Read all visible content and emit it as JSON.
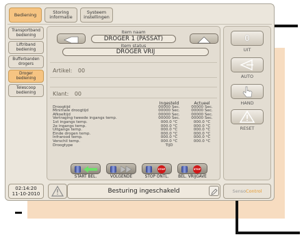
{
  "tabs": [
    {
      "label": "Bediening",
      "active": true
    },
    {
      "label": "Storing informatie",
      "active": false
    },
    {
      "label": "Systeem instellingen",
      "active": false
    }
  ],
  "sidebar": {
    "items": [
      {
        "label": "Transportband bediening",
        "active": false
      },
      {
        "label": "Liftriband bediening",
        "active": false
      },
      {
        "label": "Bufferbanden drogers",
        "active": false
      },
      {
        "label": "Droger bediening",
        "active": true
      },
      {
        "label": "Telescoop bediening",
        "active": false
      }
    ]
  },
  "item": {
    "name_label": "Item naam",
    "name_value": "DROGER 1 (PASSAT)",
    "status_label": "Item status",
    "status_value": "DROGER VRIJ"
  },
  "artikel": {
    "label": "Artikel:",
    "value": "00"
  },
  "klant": {
    "label": "Klant:",
    "value": "00"
  },
  "table": {
    "headers": {
      "set": "Ingesteld",
      "actual": "Actueel"
    },
    "rows": [
      {
        "label": "Droogtijd",
        "set": "00000 Sec.",
        "actual": "00000 Sec."
      },
      {
        "label": "Minimale droogtijd",
        "set": "00000 Sec.",
        "actual": "00000 Sec."
      },
      {
        "label": "Afkoeltijd",
        "set": "00000 Sec.",
        "actual": "00000 Sec."
      },
      {
        "label": "Vertraging tweede ingangs temp.",
        "set": "00000 Sec.",
        "actual": "00000 Sec."
      },
      {
        "label": "1st ingangs temp.",
        "set": "000.0 °C",
        "actual": "000.0 °C"
      },
      {
        "label": "2e ingangs temp.",
        "set": "000.0 °C",
        "actual": "000.0 °C"
      },
      {
        "label": "Uitgangs temp.",
        "set": "000.0 °C",
        "actual": "000.0 °C"
      },
      {
        "label": "Einde drogen temp.",
        "set": "000.0 °C",
        "actual": "000.0 °C"
      },
      {
        "label": "Infrarood temp.",
        "set": "000.0 °C",
        "actual": "000.0 °C"
      },
      {
        "label": "Verschil temp.",
        "set": "000.0 °C",
        "actual": "000.0 °C"
      },
      {
        "label": "Droogtype",
        "set": "TIJD",
        "actual": ""
      }
    ]
  },
  "actions": [
    {
      "label": "START BEL."
    },
    {
      "label": "VOLGENDE"
    },
    {
      "label": "STOP ONTL."
    },
    {
      "label": "BEL. VRIJGAVE"
    }
  ],
  "stop_text": "STOP",
  "modes": {
    "uit": {
      "glyph": "0",
      "label": "UIT"
    },
    "auto": {
      "label": "AUTO"
    },
    "hand": {
      "label": "HAND"
    },
    "reset": {
      "glyph": "!",
      "label": "RESET"
    }
  },
  "footer": {
    "time": "02:14:20",
    "date": "11-10-2010",
    "status": "Besturing ingeschakeld",
    "brand_prefix": "Senso",
    "brand_suffix": "Control"
  },
  "colors": {
    "accent": "#f6c482",
    "brand_suffix": "#e69a2e",
    "stop": "#d01818"
  }
}
